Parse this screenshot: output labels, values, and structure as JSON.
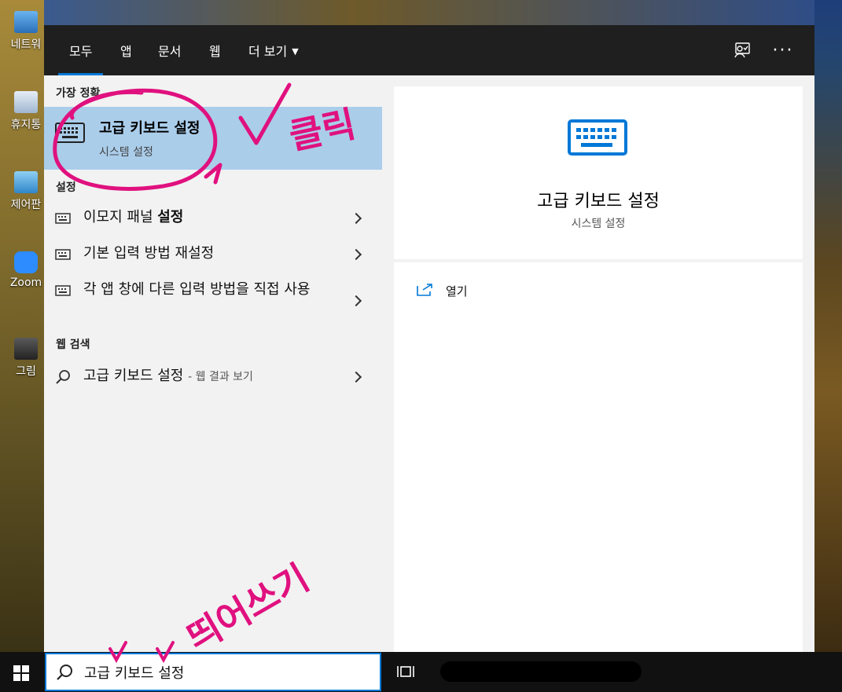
{
  "desktop": {
    "icons": [
      {
        "label": "네트워",
        "icon": "network-icon"
      },
      {
        "label": "휴지통",
        "icon": "recycle-bin-icon"
      },
      {
        "label": "제어판",
        "icon": "control-panel-icon"
      },
      {
        "label": "Zoom",
        "icon": "zoom-icon"
      },
      {
        "label": "그림",
        "icon": "picture-icon"
      }
    ]
  },
  "tabs": [
    {
      "label": "모두",
      "active": true
    },
    {
      "label": "앱"
    },
    {
      "label": "문서"
    },
    {
      "label": "웹"
    },
    {
      "label": "더 보기"
    }
  ],
  "topbar_icons": [
    "feedback-icon",
    "more-icon"
  ],
  "results": {
    "best_match_header": "가장 정확",
    "best_match": {
      "title": "고급 키보드 설정",
      "subtitle": "시스템 설정",
      "icon": "keyboard-icon"
    },
    "settings_header": "설정",
    "settings": [
      {
        "label": "이모지 패널 ",
        "bold": "설정"
      },
      {
        "label": "기본 입력 방법 재설정"
      },
      {
        "label": "각 앱 창에 다른 입력 방법을 직접 사용"
      }
    ],
    "web_header": "웹 검색",
    "web": {
      "label": "고급 키보드 설정",
      "suffix": "- 웹 결과 보기"
    }
  },
  "preview": {
    "title": "고급 키보드 설정",
    "subtitle": "시스템 설정",
    "open_label": "열기"
  },
  "taskbar": {
    "search_value": "고급 키보드 설정"
  },
  "annotations": {
    "click_text": "클릭",
    "type_text": "띄어쓰기",
    "color": "#e0117f"
  },
  "colors": {
    "accent": "#0078d7",
    "highlight": "#aacdea"
  }
}
